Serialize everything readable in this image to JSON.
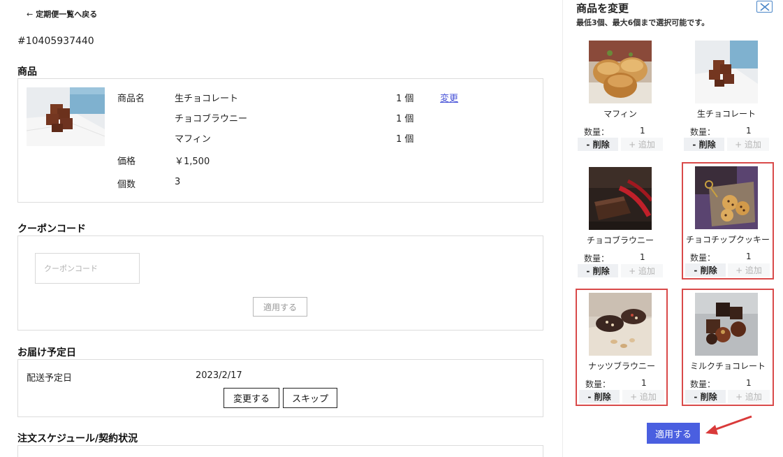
{
  "back_link": "定期便一覧へ戻る",
  "order_id": "#10405937440",
  "product_section": {
    "title": "商品",
    "name_label": "商品名",
    "items": [
      {
        "name": "生チョコレート",
        "qty": "1 個"
      },
      {
        "name": "チョコブラウニー",
        "qty": "1 個"
      },
      {
        "name": "マフィン",
        "qty": "1 個"
      }
    ],
    "change_link": "変更",
    "price_label": "価格",
    "price_value": "￥1,500",
    "count_label": "個数",
    "count_value": "3"
  },
  "coupon_section": {
    "title": "クーポンコード",
    "placeholder": "クーポンコード",
    "apply_label": "適用する"
  },
  "delivery_section": {
    "title": "お届け予定日",
    "label": "配送予定日",
    "date": "2023/2/17",
    "change_button": "変更する",
    "skip_button": "スキップ"
  },
  "schedule_section": {
    "title": "注文スケジュール/契約状況"
  },
  "panel": {
    "title": "商品を変更",
    "subtitle": "最低3個、最大6個まで選択可能です。",
    "qty_label": "数量：",
    "delete_label": "- 削除",
    "add_label": "+ 追加",
    "apply_label": "適用する",
    "products": [
      {
        "name": "マフィン",
        "qty": "1",
        "selected": false,
        "icon": "muffin-photo"
      },
      {
        "name": "生チョコレート",
        "qty": "1",
        "selected": false,
        "icon": "nama-chocolate-photo"
      },
      {
        "name": "チョコブラウニー",
        "qty": "1",
        "selected": false,
        "icon": "brownie-photo"
      },
      {
        "name": "チョコチップクッキー",
        "qty": "1",
        "selected": true,
        "icon": "cookie-photo"
      },
      {
        "name": "ナッツブラウニー",
        "qty": "1",
        "selected": true,
        "icon": "nut-brownie-photo"
      },
      {
        "name": "ミルクチョコレート",
        "qty": "1",
        "selected": true,
        "icon": "milk-chocolate-photo"
      }
    ]
  },
  "colors": {
    "accent_blue": "#4a5fe0",
    "link_blue": "#4a55d8",
    "highlight_red": "#d94a4a"
  }
}
